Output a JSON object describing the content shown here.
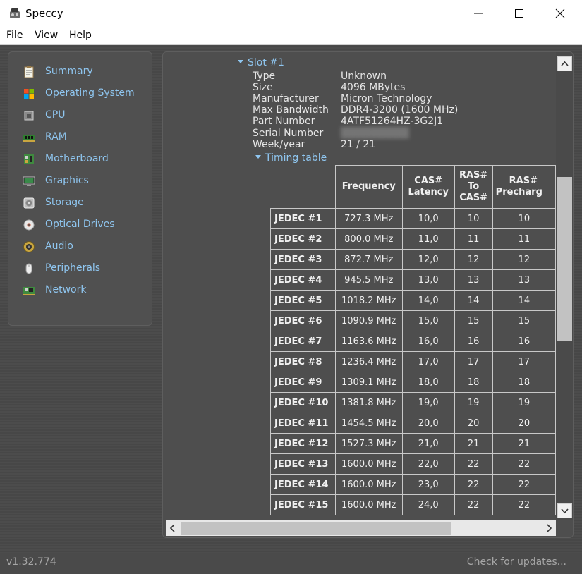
{
  "window": {
    "title": "Speccy"
  },
  "menu": {
    "file": "File",
    "view": "View",
    "help": "Help"
  },
  "sidebar": {
    "items": [
      {
        "label": "Summary",
        "icon": "clipboard-icon"
      },
      {
        "label": "Operating System",
        "icon": "windows-logo-icon"
      },
      {
        "label": "CPU",
        "icon": "cpu-chip-icon"
      },
      {
        "label": "RAM",
        "icon": "ram-module-icon"
      },
      {
        "label": "Motherboard",
        "icon": "motherboard-icon"
      },
      {
        "label": "Graphics",
        "icon": "monitor-icon"
      },
      {
        "label": "Storage",
        "icon": "hard-drive-icon"
      },
      {
        "label": "Optical Drives",
        "icon": "optical-disc-icon"
      },
      {
        "label": "Audio",
        "icon": "speaker-icon"
      },
      {
        "label": "Peripherals",
        "icon": "mouse-icon"
      },
      {
        "label": "Network",
        "icon": "network-card-icon"
      }
    ]
  },
  "slot": {
    "title": "Slot #1",
    "properties": [
      {
        "label": "Type",
        "value": "Unknown"
      },
      {
        "label": "Size",
        "value": "4096 MBytes"
      },
      {
        "label": "Manufacturer",
        "value": "Micron Technology"
      },
      {
        "label": "Max Bandwidth",
        "value": "DDR4-3200 (1600 MHz)"
      },
      {
        "label": "Part Number",
        "value": "4ATF51264HZ-3G2J1"
      },
      {
        "label": "Serial Number",
        "value": ""
      },
      {
        "label": "Week/year",
        "value": "21 / 21"
      }
    ],
    "timing_title": "Timing table"
  },
  "timing": {
    "headers": [
      "Frequency",
      "CAS# Latency",
      "RAS# To CAS#",
      "RAS# Precharge"
    ],
    "header_visible": [
      "Frequency",
      "CAS#\nLatency",
      "RAS#\nTo\nCAS#",
      "RAS#\nPrecharg"
    ],
    "rows": [
      [
        "JEDEC #1",
        "727.3 MHz",
        "10,0",
        "10",
        "10"
      ],
      [
        "JEDEC #2",
        "800.0 MHz",
        "11,0",
        "11",
        "11"
      ],
      [
        "JEDEC #3",
        "872.7 MHz",
        "12,0",
        "12",
        "12"
      ],
      [
        "JEDEC #4",
        "945.5 MHz",
        "13,0",
        "13",
        "13"
      ],
      [
        "JEDEC #5",
        "1018.2 MHz",
        "14,0",
        "14",
        "14"
      ],
      [
        "JEDEC #6",
        "1090.9 MHz",
        "15,0",
        "15",
        "15"
      ],
      [
        "JEDEC #7",
        "1163.6 MHz",
        "16,0",
        "16",
        "16"
      ],
      [
        "JEDEC #8",
        "1236.4 MHz",
        "17,0",
        "17",
        "17"
      ],
      [
        "JEDEC #9",
        "1309.1 MHz",
        "18,0",
        "18",
        "18"
      ],
      [
        "JEDEC #10",
        "1381.8 MHz",
        "19,0",
        "19",
        "19"
      ],
      [
        "JEDEC #11",
        "1454.5 MHz",
        "20,0",
        "20",
        "20"
      ],
      [
        "JEDEC #12",
        "1527.3 MHz",
        "21,0",
        "21",
        "21"
      ],
      [
        "JEDEC #13",
        "1600.0 MHz",
        "22,0",
        "22",
        "22"
      ],
      [
        "JEDEC #14",
        "1600.0 MHz",
        "23,0",
        "22",
        "22"
      ],
      [
        "JEDEC #15",
        "1600.0 MHz",
        "24,0",
        "22",
        "22"
      ]
    ]
  },
  "status": {
    "version": "v1.32.774",
    "updates": "Check for updates..."
  },
  "colors": {
    "accent": "#8fc6f0",
    "background": "#4a4a4a",
    "text": "#e6e6e6"
  }
}
